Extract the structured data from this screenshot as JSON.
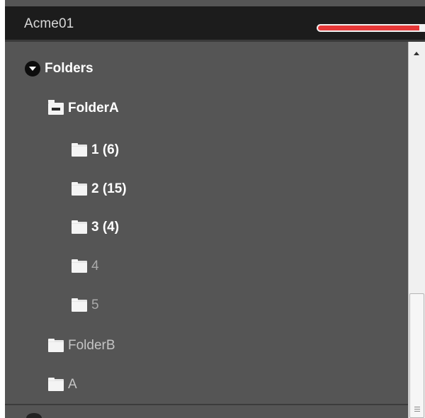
{
  "header": {
    "title": "Acme01",
    "progress_fraction": 0.95,
    "progress_color": "#e53737"
  },
  "tree": {
    "root": {
      "label": "Folders",
      "icon": "collapse-circle-icon"
    },
    "folderA": {
      "label": "FolderA",
      "icon": "folder-open-icon"
    },
    "folderA_children": [
      {
        "label": "1 (6)"
      },
      {
        "label": "2 (15)"
      },
      {
        "label": "3 (4)"
      },
      {
        "label": "4"
      },
      {
        "label": "5"
      }
    ],
    "folderB": {
      "label": "FolderB"
    },
    "folderA2": {
      "label": "A"
    }
  },
  "colors": {
    "panel_bg": "#555555",
    "header_bg": "#1c1c1c",
    "text_bold": "#ffffff",
    "text_dim": "#c4c4c4"
  }
}
